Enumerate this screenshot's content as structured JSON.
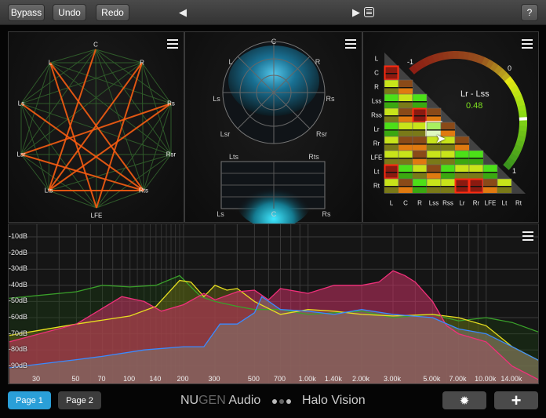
{
  "toolbar": {
    "bypass": "Bypass",
    "undo": "Undo",
    "redo": "Redo",
    "help": "?",
    "prev_icon": "triangle-left",
    "play_icon": "play-list"
  },
  "speaker_panel": {
    "speakers": [
      "C",
      "R",
      "Rs",
      "Rsr",
      "Rts",
      "LFE",
      "Lts",
      "Lsr",
      "Ls",
      "L"
    ]
  },
  "sphere_panel": {
    "labels": {
      "c": "C",
      "l": "L",
      "r": "R",
      "ls": "Ls",
      "rs": "Rs",
      "lsr": "Lsr",
      "rsr": "Rsr"
    },
    "height_labels": {
      "lts": "Lts",
      "rts": "Rts",
      "ls": "Ls",
      "c": "C",
      "rs": "Rs"
    }
  },
  "matrix_panel": {
    "rows": [
      "L",
      "C",
      "R",
      "Lss",
      "Rss",
      "Lr",
      "Rr",
      "LFE",
      "Lt",
      "Rt"
    ],
    "cols": [
      "L",
      "C",
      "R",
      "Lss",
      "Rss",
      "Lr",
      "Rr",
      "LFE",
      "Lt",
      "Rt"
    ],
    "cells": [
      [],
      [
        "R"
      ],
      [
        "y",
        "b"
      ],
      [
        "g",
        "y",
        "g"
      ],
      [
        "y",
        "b",
        "R",
        "b"
      ],
      [
        "g",
        "y",
        "y",
        "s",
        "b"
      ],
      [
        "y",
        "b",
        "b",
        "y",
        "y",
        "b"
      ],
      [
        "y",
        "y",
        "b",
        "y",
        "y",
        "g",
        "g"
      ],
      [
        "R",
        "g",
        "y",
        "b",
        "g",
        "y",
        "y",
        "g"
      ],
      [
        "y",
        "b",
        "g",
        "y",
        "y",
        "R",
        "R",
        "b",
        "y"
      ]
    ],
    "gauge": {
      "min_label": "-1",
      "mid_label": "0",
      "max_label": "1",
      "pair": "Lr - Lss",
      "value": "0.48",
      "value_num": 0.48
    }
  },
  "spectrum": {
    "db_labels": [
      "-10dB",
      "-20dB",
      "-30dB",
      "-40dB",
      "-50dB",
      "-60dB",
      "-70dB",
      "-80dB",
      "-90dB"
    ],
    "freq_labels": [
      [
        "30",
        30
      ],
      [
        "50",
        50
      ],
      [
        "70",
        70
      ],
      [
        "100",
        100
      ],
      [
        "140",
        140
      ],
      [
        "200",
        200
      ],
      [
        "300",
        300
      ],
      [
        "500",
        500
      ],
      [
        "700",
        700
      ],
      [
        "1.00k",
        1000
      ],
      [
        "1.40k",
        1400
      ],
      [
        "2.00k",
        2000
      ],
      [
        "3.00k",
        3000
      ],
      [
        "5.00k",
        5000
      ],
      [
        "7.00k",
        7000
      ],
      [
        "10.00k",
        10000
      ],
      [
        "14.00k",
        14000
      ]
    ],
    "series": [
      {
        "name": "green",
        "color": "#3aa02a",
        "fill": "rgba(30,70,20,0.35)",
        "points": [
          [
            21,
            -48
          ],
          [
            50,
            -44
          ],
          [
            70,
            -40
          ],
          [
            100,
            -41
          ],
          [
            140,
            -40
          ],
          [
            190,
            -34
          ],
          [
            250,
            -47
          ],
          [
            300,
            -50
          ],
          [
            400,
            -53
          ],
          [
            500,
            -55
          ],
          [
            700,
            -55
          ],
          [
            1000,
            -58
          ],
          [
            1400,
            -57
          ],
          [
            2000,
            -56
          ],
          [
            3000,
            -60
          ],
          [
            5000,
            -58
          ],
          [
            7000,
            -62
          ],
          [
            10000,
            -60
          ],
          [
            14000,
            -63
          ],
          [
            21000,
            -70
          ]
        ]
      },
      {
        "name": "yellow",
        "color": "#e8e020",
        "fill": "rgba(110,110,20,0.45)",
        "points": [
          [
            21,
            -71
          ],
          [
            50,
            -64
          ],
          [
            100,
            -59
          ],
          [
            140,
            -53
          ],
          [
            190,
            -37
          ],
          [
            220,
            -38
          ],
          [
            260,
            -47
          ],
          [
            300,
            -40
          ],
          [
            350,
            -43
          ],
          [
            400,
            -42
          ],
          [
            500,
            -50
          ],
          [
            700,
            -58
          ],
          [
            1000,
            -55
          ],
          [
            1400,
            -56
          ],
          [
            2000,
            -58
          ],
          [
            3000,
            -59
          ],
          [
            5000,
            -58
          ],
          [
            7000,
            -60
          ],
          [
            10000,
            -65
          ],
          [
            14000,
            -78
          ],
          [
            21000,
            -88
          ]
        ]
      },
      {
        "name": "pink",
        "color": "#f0307a",
        "fill": "rgba(200,50,100,0.55)",
        "points": [
          [
            21,
            -75
          ],
          [
            50,
            -64
          ],
          [
            90,
            -47
          ],
          [
            120,
            -50
          ],
          [
            150,
            -56
          ],
          [
            200,
            -52
          ],
          [
            260,
            -45
          ],
          [
            300,
            -49
          ],
          [
            400,
            -44
          ],
          [
            500,
            -43
          ],
          [
            600,
            -49
          ],
          [
            700,
            -42
          ],
          [
            1000,
            -45
          ],
          [
            1400,
            -40
          ],
          [
            2000,
            -40
          ],
          [
            2500,
            -38
          ],
          [
            3000,
            -31
          ],
          [
            3500,
            -34
          ],
          [
            4000,
            -38
          ],
          [
            5000,
            -50
          ],
          [
            6000,
            -65
          ],
          [
            7000,
            -70
          ],
          [
            10000,
            -75
          ],
          [
            14000,
            -90
          ],
          [
            21000,
            -100
          ]
        ]
      },
      {
        "name": "blue",
        "color": "#3a8aff",
        "fill": "rgba(130,120,110,0.55)",
        "points": [
          [
            21,
            -91
          ],
          [
            50,
            -86
          ],
          [
            70,
            -84
          ],
          [
            120,
            -80
          ],
          [
            200,
            -78
          ],
          [
            260,
            -78
          ],
          [
            320,
            -64
          ],
          [
            400,
            -64
          ],
          [
            500,
            -57
          ],
          [
            550,
            -47
          ],
          [
            700,
            -55
          ],
          [
            1000,
            -56
          ],
          [
            1400,
            -58
          ],
          [
            2000,
            -55
          ],
          [
            3000,
            -58
          ],
          [
            5000,
            -60
          ],
          [
            7000,
            -67
          ],
          [
            10000,
            -70
          ],
          [
            14000,
            -78
          ],
          [
            21000,
            -88
          ]
        ]
      }
    ]
  },
  "footer": {
    "page1": "Page 1",
    "page2": "Page 2",
    "brand_nu": "NU",
    "brand_gen": "GEN",
    "brand_audio": " Audio",
    "product": "Halo Vision",
    "settings_icon": "gear",
    "add_icon": "plus"
  },
  "colors": {
    "accent": "#2a9fd8"
  }
}
